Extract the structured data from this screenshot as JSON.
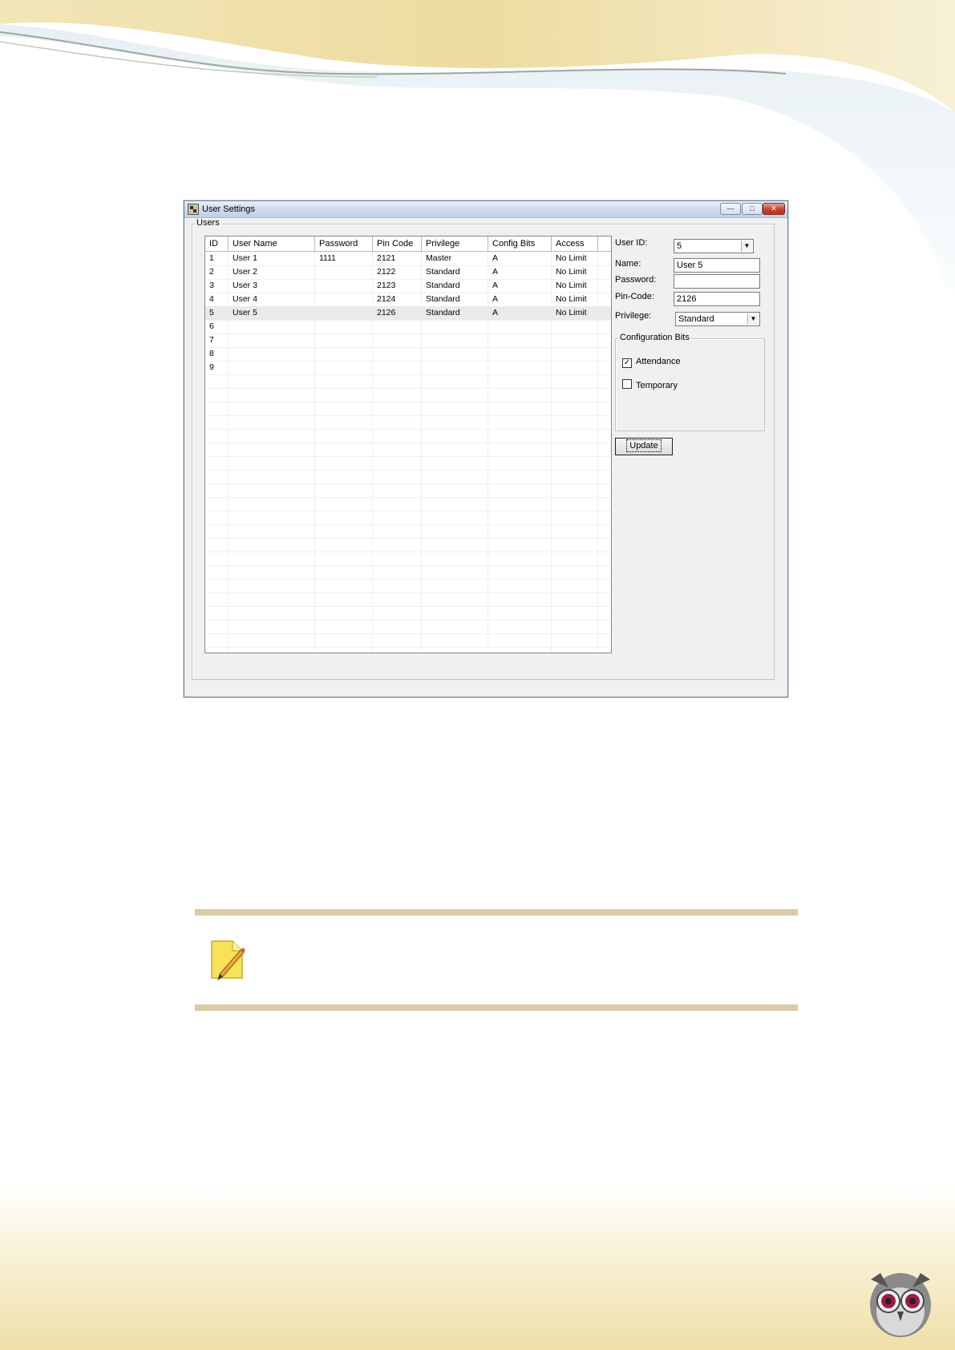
{
  "window": {
    "title": "User Settings",
    "min_glyph": "—",
    "max_glyph": "□",
    "close_glyph": "✕"
  },
  "users_group": {
    "label": "Users",
    "columns": [
      "ID",
      "User Name",
      "Password",
      "Pin Code",
      "Privilege",
      "Config Bits",
      "Access"
    ],
    "rows": [
      [
        "1",
        "User 1",
        "1111",
        "2121",
        "Master",
        "A",
        "No Limit"
      ],
      [
        "2",
        "User 2",
        "",
        "2122",
        "Standard",
        "A",
        "No Limit"
      ],
      [
        "3",
        "User 3",
        "",
        "2123",
        "Standard",
        "A",
        "No Limit"
      ],
      [
        "4",
        "User 4",
        "",
        "2124",
        "Standard",
        "A",
        "No Limit"
      ],
      [
        "5",
        "User 5",
        "",
        "2126",
        "Standard",
        "A",
        "No Limit"
      ],
      [
        "6",
        "",
        "",
        "",
        "",
        "",
        ""
      ],
      [
        "7",
        "",
        "",
        "",
        "",
        "",
        ""
      ],
      [
        "8",
        "",
        "",
        "",
        "",
        "",
        ""
      ],
      [
        "9",
        "",
        "",
        "",
        "",
        "",
        ""
      ]
    ],
    "selected_row": 5
  },
  "form": {
    "user_id_label": "User ID:",
    "user_id_value": "5",
    "name_label": "Name:",
    "name_value": "User 5",
    "password_label": "Password:",
    "password_value": "",
    "pin_code_label": "Pin-Code:",
    "pin_code_value": "2126",
    "privilege_label": "Privilege:",
    "privilege_value": "Standard",
    "config_bits": {
      "label": "Configuration Bits",
      "attendance_label": "Attendance",
      "attendance_checked": true,
      "temporary_label": "Temporary",
      "temporary_checked": false
    },
    "update_label": "Update"
  },
  "icons": {
    "app": "app-settings-icon",
    "note": "note-pencil-icon",
    "logo": "owl-logo"
  },
  "colors": {
    "note_rule": "#d8cba6",
    "page_band": "#efe0a8"
  }
}
